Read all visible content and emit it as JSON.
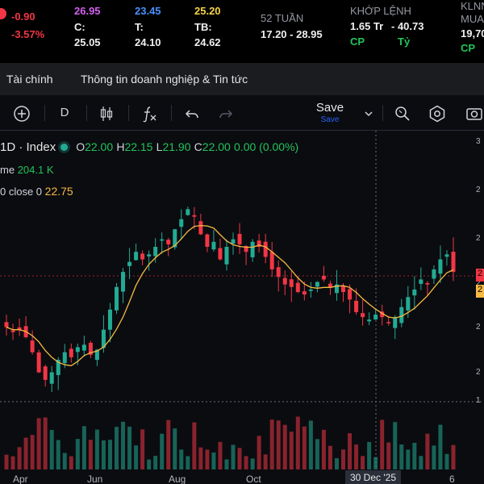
{
  "quote": {
    "change": "-0.90",
    "change_pct": "-3.57%",
    "ceiling": "26.95",
    "ceiling_code": "C:",
    "ceiling_price": "25.05",
    "floor": "23.45",
    "floor_code": "T:",
    "floor_price": "24.10",
    "ref": "25.20",
    "ref_code": "TB:",
    "ref_price": "24.62",
    "week52_label": "52 TUẦN",
    "week52_range": "17.20 - 28.95",
    "matched_label": "KHỚP LỆNH",
    "matched_volume": "1.65 Tr",
    "matched_value": "- 40.73",
    "matched_unit": "CP",
    "matched_unit2": "Tỷ",
    "foreign_label": "KLNN",
    "foreign_side": "MUA",
    "foreign_value": "19,70",
    "foreign_unit": "CP"
  },
  "tabs": [
    {
      "label": "Tài chính"
    },
    {
      "label": "Thông tin doanh nghiệp & Tin tức"
    }
  ],
  "toolbar": {
    "interval": "D",
    "save_label": "Save",
    "save_sub": "Save"
  },
  "legend": {
    "symbol": "1D · Index",
    "open_label": "O",
    "open": "22.00",
    "high_label": "H",
    "high": "22.15",
    "low_label": "L",
    "low": "21.90",
    "close_label": "C",
    "close": "22.00",
    "change": "0.00 (0.00%)",
    "volume_label": "me",
    "volume_value": "204.1 K",
    "ma_label": "0 close 0",
    "ma_value": "22.75"
  },
  "axis": {
    "right_labels": [
      "3",
      "2",
      "2",
      "2",
      "2",
      "2",
      "1"
    ],
    "tag_top": "2",
    "tag_bottom": "2",
    "x_labels": [
      "Apr",
      "Jun",
      "Aug",
      "Oct",
      "6"
    ],
    "x_cursor": "30 Dec '25"
  },
  "colors": {
    "up": "#22ab94",
    "down": "#f23645",
    "ma": "#f5b942",
    "background": "#0b0c10"
  },
  "chart_data": {
    "type": "candlestick",
    "x_labels": [
      "Apr",
      "Jun",
      "Aug",
      "Oct",
      "30 Dec '25",
      "6"
    ],
    "series": [
      {
        "values": [
          23.6,
          23.4,
          23.5,
          23.2,
          22.6,
          21.8,
          21.5,
          21.8,
          22.3,
          22.6,
          22.4,
          22.8,
          22.9,
          22.5,
          22.7,
          23.5,
          24.3,
          25.2,
          25.8,
          26.2,
          26.6,
          26.3,
          26.5,
          26.8,
          27.1,
          26.9,
          27.5,
          27.9,
          28.3,
          28.0,
          27.3,
          26.8,
          27.0,
          26.3,
          26.8,
          27.1,
          26.9,
          26.6,
          27.0,
          26.8,
          26.4,
          25.9,
          25.6,
          25.3,
          25.2,
          25.0,
          24.9,
          25.1,
          25.4,
          25.5,
          25.2,
          25.3,
          25.0,
          24.7,
          24.2,
          24.0,
          23.9,
          24.1,
          24.0,
          23.8,
          24.0,
          24.4,
          24.8,
          25.1,
          25.5,
          25.3,
          25.9,
          26.3,
          26.5,
          25.8
        ]
      }
    ]
  }
}
